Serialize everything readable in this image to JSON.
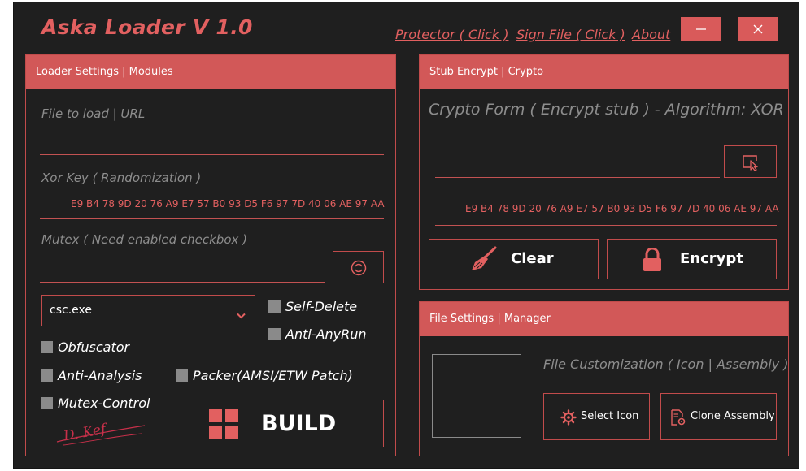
{
  "app": {
    "title": "Aska Loader V 1.0",
    "links": [
      "Protector ( Click )",
      "Sign File ( Click )",
      "About"
    ],
    "minimize_icon": "minimize-icon",
    "close_icon": "close-icon"
  },
  "loader": {
    "header": "Loader Settings | Modules",
    "file_placeholder": "File to load | URL",
    "xor_label": "Xor Key ( Randomization )",
    "xor_value": "E9 B4 78 9D 20 76 A9 E7 57 B0 93 D5 F6 97 7D 40 06 AE 97 AA",
    "mutex_placeholder": "Mutex ( Need enabled checkbox )",
    "process_select": "csc.exe",
    "checkboxes": {
      "self_delete": "Self-Delete",
      "anti_anyrun": "Anti-AnyRun",
      "obfuscator": "Obfuscator",
      "anti_analysis": "Anti-Analysis",
      "packer": "Packer(AMSI/ETW Patch)",
      "mutex_control": "Mutex-Control"
    },
    "build_label": "BUILD",
    "signature": "D. Kef"
  },
  "stub": {
    "header": "Stub Encrypt | Crypto",
    "crypto_label": "Crypto Form ( Encrypt stub ) - Algorithm: XOR",
    "key_value": "E9 B4 78 9D 20 76 A9 E7 57 B0 93 D5 F6 97 7D 40 06 AE 97 AA",
    "clear_label": "Clear",
    "encrypt_label": "Encrypt"
  },
  "file_settings": {
    "header": "File Settings | Manager",
    "customization_label": "File Customization ( Icon | Assembly )",
    "select_icon_label": "Select Icon",
    "clone_assembly_label": "Clone Assembly"
  },
  "colors": {
    "accent": "#d25858",
    "accent_text": "#e26060",
    "background": "#1f1f1f",
    "checkbox": "#8a8a8a",
    "hint_text": "#8d8d8d"
  }
}
